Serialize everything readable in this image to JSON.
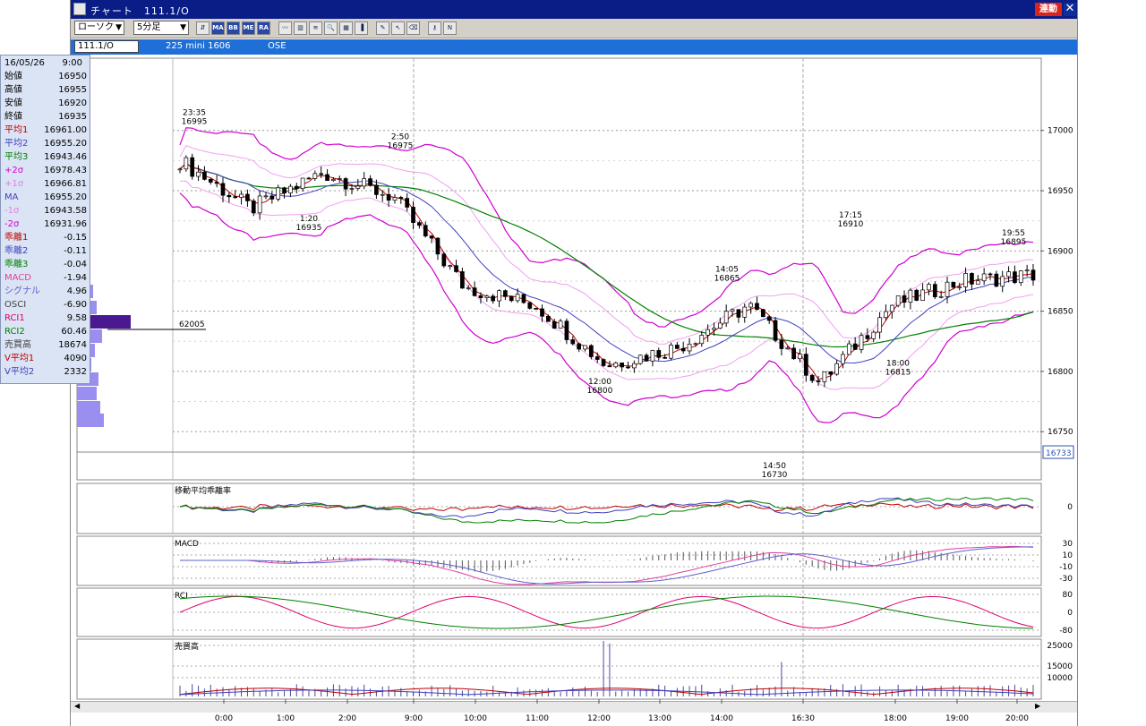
{
  "window": {
    "title": "チャート　111.1/O",
    "link_label": "連動",
    "close_label": "✕"
  },
  "toolbar": {
    "chart_type": "ローソク",
    "interval": "5分足",
    "buttons": [
      {
        "name": "compare-icon",
        "label": "⇵"
      },
      {
        "name": "ma-icon",
        "label": "MA"
      },
      {
        "name": "bb-icon",
        "label": "BB"
      },
      {
        "name": "me-icon",
        "label": "ME"
      },
      {
        "name": "ra-icon",
        "label": "RA"
      },
      {
        "name": "line-icon",
        "label": "〰"
      },
      {
        "name": "candle-icon",
        "label": "▥"
      },
      {
        "name": "wave-icon",
        "label": "≋"
      },
      {
        "name": "zoom-icon",
        "label": "🔍"
      },
      {
        "name": "table-icon",
        "label": "▦"
      },
      {
        "name": "bar-icon",
        "label": "▐"
      },
      {
        "name": "pen-icon",
        "label": "✎"
      },
      {
        "name": "cursor-icon",
        "label": "↖"
      },
      {
        "name": "eraser-icon",
        "label": "⌫"
      },
      {
        "name": "key-icon",
        "label": "⚷"
      },
      {
        "name": "trend-icon",
        "label": "N"
      }
    ]
  },
  "symbol_bar": {
    "symbol": "111.1/O",
    "description": "225 mini 1606",
    "exchange": "OSE"
  },
  "info_panel": {
    "date": "16/05/26",
    "time": "9:00",
    "rows": [
      {
        "label": "始値",
        "value": "16950",
        "color": "#000000"
      },
      {
        "label": "高値",
        "value": "16955",
        "color": "#000000"
      },
      {
        "label": "安値",
        "value": "16920",
        "color": "#000000"
      },
      {
        "label": "終値",
        "value": "16935",
        "color": "#000000"
      },
      {
        "label": "平均1",
        "value": "16961.00",
        "color": "#c00000"
      },
      {
        "label": "平均2",
        "value": "16955.20",
        "color": "#4040c0"
      },
      {
        "label": "平均3",
        "value": "16943.46",
        "color": "#008000"
      },
      {
        "label": "+2σ",
        "value": "16978.43",
        "color": "#d000d0"
      },
      {
        "label": "+1σ",
        "value": "16966.81",
        "color": "#e080e0"
      },
      {
        "label": "MA",
        "value": "16955.20",
        "color": "#4040c0"
      },
      {
        "label": "-1σ",
        "value": "16943.58",
        "color": "#e080e0"
      },
      {
        "label": "-2σ",
        "value": "16931.96",
        "color": "#d000d0"
      },
      {
        "label": "乖離1",
        "value": "-0.15",
        "color": "#c00000"
      },
      {
        "label": "乖離2",
        "value": "-0.11",
        "color": "#4040c0"
      },
      {
        "label": "乖離3",
        "value": "-0.04",
        "color": "#008000"
      },
      {
        "label": "MACD",
        "value": "-1.94",
        "color": "#e040a0"
      },
      {
        "label": "シグナル",
        "value": "4.96",
        "color": "#6060d0"
      },
      {
        "label": "OSCI",
        "value": "-6.90",
        "color": "#404040"
      },
      {
        "label": "RCI1",
        "value": "9.58",
        "color": "#e0006a"
      },
      {
        "label": "RCI2",
        "value": "60.46",
        "color": "#008000"
      },
      {
        "label": "売買高",
        "value": "18674",
        "color": "#404040"
      },
      {
        "label": "V平均1",
        "value": "4090",
        "color": "#c00000"
      },
      {
        "label": "V平均2",
        "value": "2332",
        "color": "#4040c0"
      }
    ]
  },
  "price_chart": {
    "y_ticks": [
      "17000",
      "16950",
      "16900",
      "16850",
      "16800",
      "16750"
    ],
    "y_values": [
      17000,
      16950,
      16900,
      16850,
      16800,
      16750
    ],
    "current_price": "16733",
    "volume_profile_label": "62005",
    "annotations": [
      {
        "time": "23:35",
        "price": "16995"
      },
      {
        "time": "1:20",
        "price": "16935"
      },
      {
        "time": "2:50",
        "price": "16975"
      },
      {
        "time": "12:00",
        "price": "16800"
      },
      {
        "time": "14:05",
        "price": "16865"
      },
      {
        "time": "14:50",
        "price": "16730"
      },
      {
        "time": "17:15",
        "price": "16910"
      },
      {
        "time": "18:00",
        "price": "16815"
      },
      {
        "time": "19:55",
        "price": "16895"
      }
    ]
  },
  "sub_panels": [
    {
      "title": "移動平均乖離率",
      "ticks": [
        "0"
      ]
    },
    {
      "title": "MACD",
      "ticks": [
        "30",
        "10",
        "-10",
        "-30"
      ]
    },
    {
      "title": "RCI",
      "ticks": [
        "80",
        "0",
        "-80"
      ]
    },
    {
      "title": "売買高",
      "ticks": [
        "25000",
        "15000",
        "10000"
      ]
    }
  ],
  "x_axis": {
    "labels": [
      "0:00",
      "1:00",
      "2:00",
      "9:00",
      "10:00",
      "11:00",
      "12:00",
      "13:00",
      "14:00",
      "16:30",
      "18:00",
      "19:00",
      "20:00"
    ]
  },
  "colors": {
    "titlebar": "#0a1c86",
    "symbol_bar": "#1e6fd8",
    "candle_up": "#ffffff",
    "candle_down": "#000000",
    "ma1": "#c00000",
    "ma2": "#4040c0",
    "ma3": "#008000",
    "band2": "#d000d0",
    "band1": "#f0a0f0"
  },
  "chart_data": {
    "type": "candlestick",
    "x": [
      "0:00",
      "1:00",
      "2:00",
      "9:00",
      "10:00",
      "11:00",
      "12:00",
      "13:00",
      "14:00",
      "16:30",
      "18:00",
      "19:00",
      "20:00"
    ],
    "close": [
      16975,
      16935,
      16965,
      16945,
      16870,
      16855,
      16805,
      16820,
      16855,
      16790,
      16855,
      16875,
      16880
    ],
    "ylim": [
      16710,
      17060
    ],
    "annotated_points": [
      {
        "x": "23:35",
        "y": 16995
      },
      {
        "x": "1:20",
        "y": 16935
      },
      {
        "x": "2:50",
        "y": 16975
      },
      {
        "x": "12:00",
        "y": 16800
      },
      {
        "x": "14:05",
        "y": 16865
      },
      {
        "x": "14:50",
        "y": 16730
      },
      {
        "x": "17:15",
        "y": 16910
      },
      {
        "x": "18:00",
        "y": 16815
      },
      {
        "x": "19:55",
        "y": 16895
      }
    ],
    "last_price": 16733,
    "grid": true
  }
}
